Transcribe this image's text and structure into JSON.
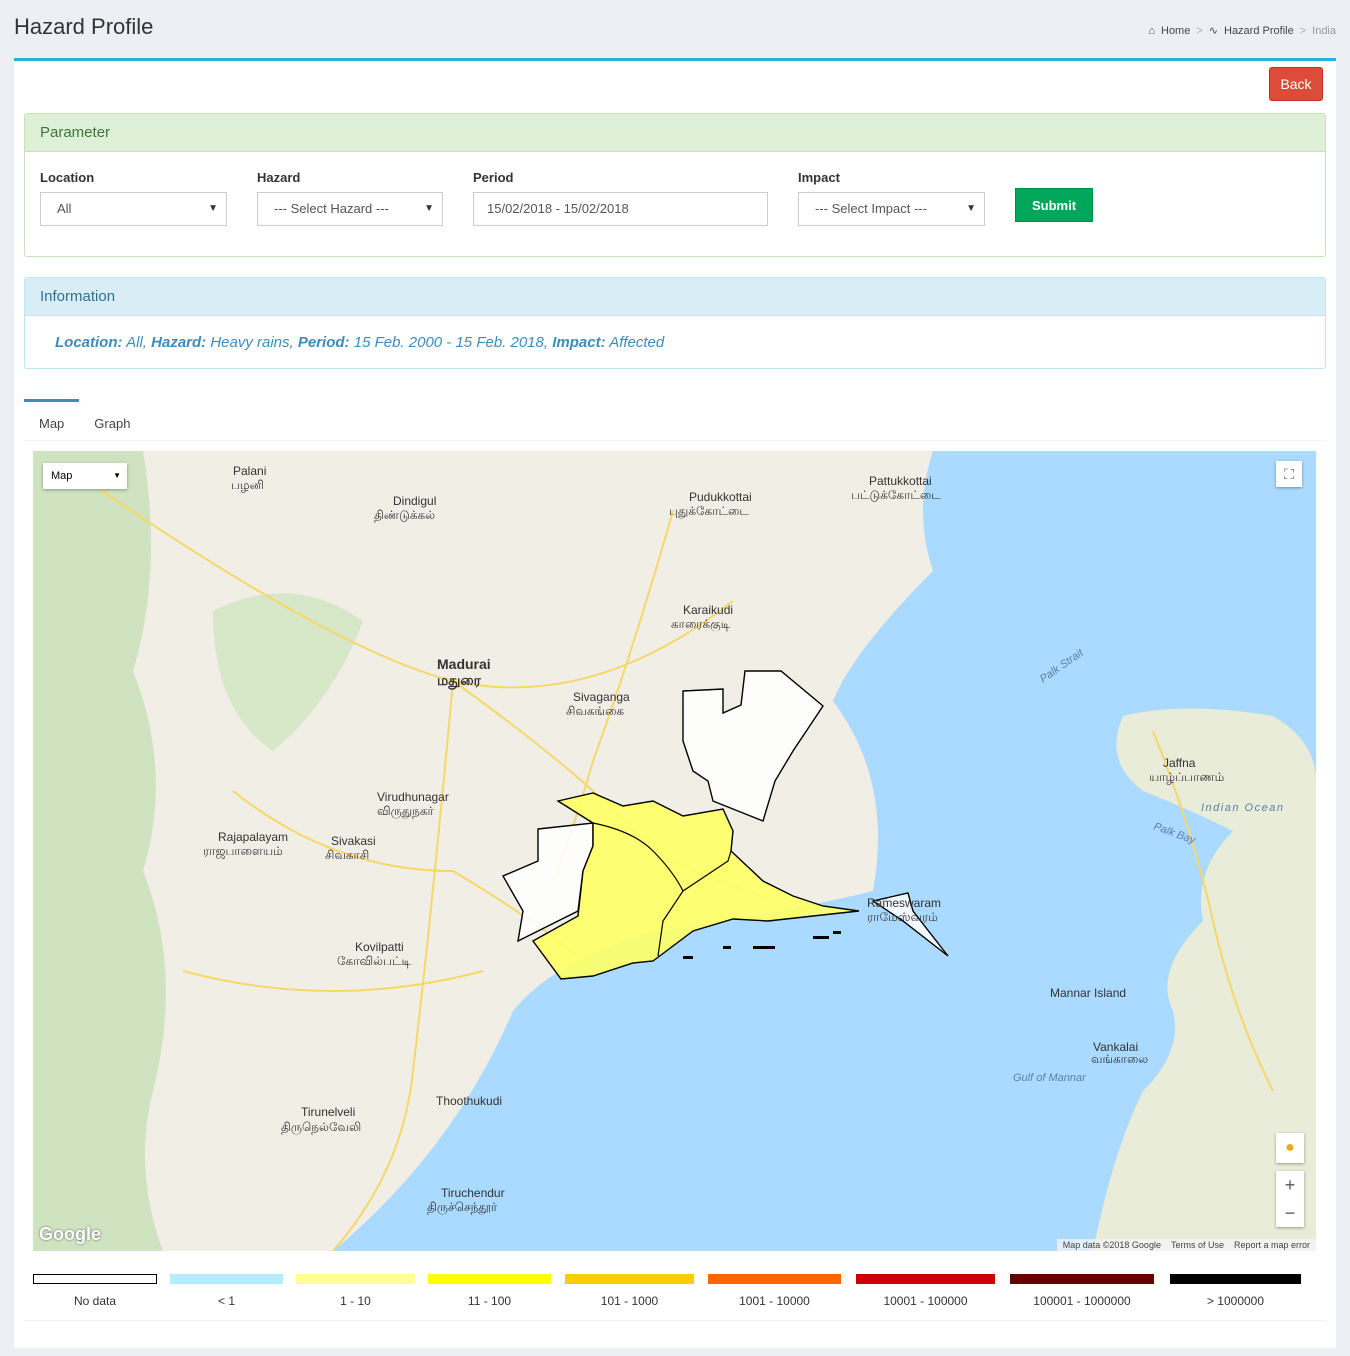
{
  "header": {
    "title": "Hazard Profile",
    "breadcrumb": {
      "home": "Home",
      "sep": ">",
      "profile": "Hazard Profile",
      "current": "India"
    }
  },
  "actions": {
    "back_label": "Back"
  },
  "parameter": {
    "heading": "Parameter",
    "location": {
      "label": "Location",
      "value": "All"
    },
    "hazard": {
      "label": "Hazard",
      "value": "--- Select Hazard ---"
    },
    "period": {
      "label": "Period",
      "value": "15/02/2018 - 15/02/2018"
    },
    "impact": {
      "label": "Impact",
      "value": "--- Select Impact ---"
    },
    "submit_label": "Submit"
  },
  "information": {
    "heading": "Information",
    "location_key": "Location:",
    "location_value": "All,",
    "hazard_key": "Hazard:",
    "hazard_value": "Heavy rains,",
    "period_key": "Period:",
    "period_value": "15 Feb. 2000 - 15 Feb. 2018,",
    "impact_key": "Impact:",
    "impact_value": "Affected"
  },
  "tabs": [
    {
      "label": "Map"
    },
    {
      "label": "Graph"
    }
  ],
  "map": {
    "type_label": "Map",
    "places": [
      {
        "id": "palani",
        "en": "Palani",
        "ta": "பழனி"
      },
      {
        "id": "dindigul",
        "en": "Dindigul",
        "ta": "திண்டுக்கல்"
      },
      {
        "id": "madurai",
        "en": "Madurai",
        "ta": "மதுரை"
      },
      {
        "id": "pudukkottai",
        "en": "Pudukkottai",
        "ta": "புதுக்கோட்டை"
      },
      {
        "id": "pattukkottai",
        "en": "Pattukkottai",
        "ta": "பட்டுக்கோட்டை"
      },
      {
        "id": "karaikudi",
        "en": "Karaikudi",
        "ta": "காரைக்குடி"
      },
      {
        "id": "sivaganga",
        "en": "Sivaganga",
        "ta": "சிவகங்கை"
      },
      {
        "id": "virudhunagar",
        "en": "Virudhunagar",
        "ta": "விருதுநகர்"
      },
      {
        "id": "sivakasi",
        "en": "Sivakasi",
        "ta": "சிவகாசி"
      },
      {
        "id": "rajapalayam",
        "en": "Rajapalayam",
        "ta": "ராஜபாளையம்"
      },
      {
        "id": "kovilpatti",
        "en": "Kovilpatti",
        "ta": "கோவில்பட்டி"
      },
      {
        "id": "thoothukudi",
        "en": "Thoothukudi",
        "ta": ""
      },
      {
        "id": "tirunelveli",
        "en": "Tirunelveli",
        "ta": "திருநெல்வேலி"
      },
      {
        "id": "rameswaram",
        "en": "Rameswaram",
        "ta": "ராமேஸ்வரம்"
      },
      {
        "id": "jaffna",
        "en": "Jaffna",
        "ta": "யாழ்ப்பாணம்"
      },
      {
        "id": "mannar",
        "en": "Mannar Island",
        "ta": ""
      },
      {
        "id": "vavuniya",
        "en": "Vankalai",
        "ta": "வங்காலை"
      },
      {
        "id": "tiruchendur",
        "en": "Tiruchendur",
        "ta": "திருச்செந்தூர்"
      }
    ],
    "water_labels": [
      "Palk Strait",
      "Palk Bay",
      "Indian Ocean",
      "Gulf of Mannar"
    ],
    "attribution": {
      "data": "Map data ©2018 Google",
      "terms": "Terms of Use",
      "report": "Report a map error"
    },
    "google": "Google"
  },
  "legend": [
    {
      "label": "No data",
      "color": "#ffffff"
    },
    {
      "label": "< 1",
      "color": "#b3ecfb"
    },
    {
      "label": "1 - 10",
      "color": "#ffff99"
    },
    {
      "label": "11 - 100",
      "color": "#ffff00"
    },
    {
      "label": "101 - 1000",
      "color": "#ffcc00"
    },
    {
      "label": "1001 - 10000",
      "color": "#ff6600"
    },
    {
      "label": "10001 - 100000",
      "color": "#cc0000"
    },
    {
      "label": "100001 - 1000000",
      "color": "#660000"
    },
    {
      "label": "> 1000000",
      "color": "#000000"
    }
  ]
}
